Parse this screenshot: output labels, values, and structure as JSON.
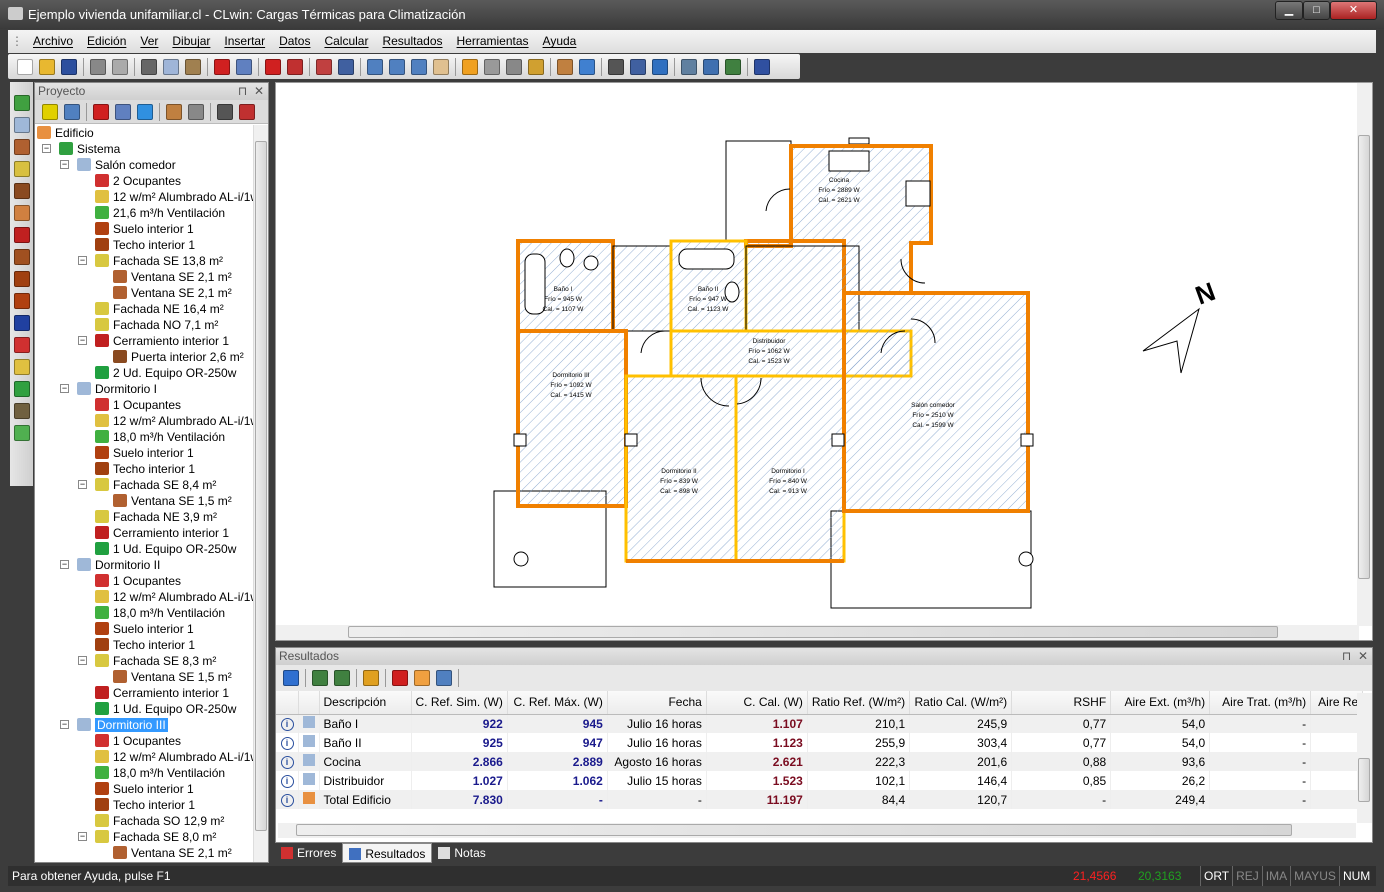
{
  "window": {
    "title": "Ejemplo vivienda unifamiliar.cl - CLwin: Cargas Térmicas para Climatización",
    "minimize": "▁",
    "maximize": "□",
    "close": "✕"
  },
  "menu": [
    "Archivo",
    "Edición",
    "Ver",
    "Dibujar",
    "Insertar",
    "Datos",
    "Calcular",
    "Resultados",
    "Herramientas",
    "Ayuda"
  ],
  "toolbar": [
    {
      "icon": "new-icon",
      "color": "#ffffff"
    },
    {
      "icon": "open-icon",
      "color": "#e8b830"
    },
    {
      "icon": "save-icon",
      "color": "#2c4f9e"
    },
    "|",
    {
      "icon": "print-icon",
      "color": "#888888"
    },
    {
      "icon": "print-preview-icon",
      "color": "#aaaaaa"
    },
    "|",
    {
      "icon": "cut-icon",
      "color": "#666666"
    },
    {
      "icon": "copy-icon",
      "color": "#9fb5d8"
    },
    {
      "icon": "paste-icon",
      "color": "#a08050"
    },
    "|",
    {
      "icon": "delete-icon",
      "color": "#d02020"
    },
    {
      "icon": "edit-icon",
      "color": "#6080c0"
    },
    "|",
    {
      "icon": "sum-icon",
      "color": "#d02020"
    },
    {
      "icon": "report-icon",
      "color": "#c03030"
    },
    "|",
    {
      "icon": "calc-icon",
      "color": "#c04040"
    },
    {
      "icon": "export-icon",
      "color": "#4060a0"
    },
    "|",
    {
      "icon": "zoom-icon",
      "color": "#5080c0"
    },
    {
      "icon": "zoom-in-icon",
      "color": "#5080c0"
    },
    {
      "icon": "zoom-out-icon",
      "color": "#5080c0"
    },
    {
      "icon": "pan-hand-icon",
      "color": "#e0c090"
    },
    "|",
    {
      "icon": "ortho-icon",
      "color": "#f0a020"
    },
    {
      "icon": "grid-icon",
      "color": "#999999"
    },
    {
      "icon": "snap-icon",
      "color": "#888888"
    },
    {
      "icon": "properties-icon",
      "color": "#d0a030"
    },
    "|",
    {
      "icon": "measure-icon",
      "color": "#c08040"
    },
    {
      "icon": "compass-icon",
      "color": "#4080d0"
    },
    "|",
    {
      "icon": "align-icon",
      "color": "#555555"
    },
    {
      "icon": "link-icon",
      "color": "#4060a0"
    },
    {
      "icon": "center-icon",
      "color": "#3070c0"
    },
    "|",
    {
      "icon": "page-icon",
      "color": "#6080a0"
    },
    {
      "icon": "page-export-icon",
      "color": "#4070b0"
    },
    {
      "icon": "page-edit-icon",
      "color": "#408040"
    },
    "|",
    {
      "icon": "layers-icon",
      "color": "#3050a0"
    }
  ],
  "left_tools": [
    {
      "icon": "add-system-icon",
      "color": "#40a040"
    },
    {
      "icon": "add-room-icon",
      "color": "#9fb8d8"
    },
    {
      "icon": "add-window-icon",
      "color": "#b06030"
    },
    {
      "icon": "add-facade-icon",
      "color": "#d8c040"
    },
    {
      "icon": "add-door-icon",
      "color": "#8a4a20"
    },
    {
      "icon": "add-roof-icon",
      "color": "#d08040"
    },
    {
      "icon": "add-wall-icon",
      "color": "#c02020"
    },
    {
      "icon": "add-interior-door-icon",
      "color": "#a05020"
    },
    {
      "icon": "add-ceiling-icon",
      "color": "#a04010"
    },
    {
      "icon": "add-floor-icon",
      "color": "#b04010"
    },
    {
      "icon": "add-pattern-icon",
      "color": "#2040a0"
    },
    {
      "icon": "add-occupants-icon",
      "color": "#d03030"
    },
    {
      "icon": "add-lighting-icon",
      "color": "#e0c040"
    },
    {
      "icon": "add-equipment-icon",
      "color": "#30a040"
    },
    {
      "icon": "add-light-icon",
      "color": "#706040"
    },
    {
      "icon": "add-ventilation-icon",
      "color": "#50b050"
    }
  ],
  "project_panel": {
    "title": "Proyecto",
    "pin": "⊓",
    "close": "✕",
    "tools": [
      {
        "icon": "add-icon",
        "color": "#e0d000"
      },
      {
        "icon": "import-icon",
        "color": "#5080c0"
      },
      "|",
      {
        "icon": "delete-icon",
        "color": "#d02020"
      },
      {
        "icon": "edit-icon",
        "color": "#6080c0"
      },
      {
        "icon": "up-arrow-icon",
        "color": "#3090e0"
      },
      "|",
      {
        "icon": "measure-icon",
        "color": "#c08040"
      },
      {
        "icon": "compass-icon",
        "color": "#888888"
      },
      "|",
      {
        "icon": "table-icon",
        "color": "#555555"
      },
      {
        "icon": "sum-icon",
        "color": "#c03030"
      }
    ],
    "tree": [
      {
        "l": 0,
        "t": "Edificio",
        "i": "building"
      },
      {
        "l": 1,
        "t": "Sistema",
        "i": "system",
        "e": "−"
      },
      {
        "l": 2,
        "t": "Salón comedor",
        "i": "room",
        "e": "−"
      },
      {
        "l": 3,
        "t": "2 Ocupantes",
        "i": "occupants"
      },
      {
        "l": 3,
        "t": "12 w/m² Alumbrado AL-i/1w",
        "i": "lighting"
      },
      {
        "l": 3,
        "t": "21,6 m³/h Ventilación",
        "i": "ventilation"
      },
      {
        "l": 3,
        "t": "Suelo interior 1",
        "i": "floor"
      },
      {
        "l": 3,
        "t": "Techo interior 1",
        "i": "ceiling"
      },
      {
        "l": 3,
        "t": "Fachada SE 13,8 m²",
        "i": "facade",
        "e": "−"
      },
      {
        "l": 4,
        "t": "Ventana SE 2,1 m²",
        "i": "window"
      },
      {
        "l": 4,
        "t": "Ventana SE 2,1 m²",
        "i": "window"
      },
      {
        "l": 3,
        "t": "Fachada NE 16,4 m²",
        "i": "facade"
      },
      {
        "l": 3,
        "t": "Fachada NO 7,1 m²",
        "i": "facade"
      },
      {
        "l": 3,
        "t": "Cerramiento interior 1",
        "i": "wall",
        "e": "−"
      },
      {
        "l": 4,
        "t": "Puerta interior 2,6 m²",
        "i": "door"
      },
      {
        "l": 3,
        "t": "2 Ud. Equipo OR-250w",
        "i": "equipment"
      },
      {
        "l": 2,
        "t": "Dormitorio I",
        "i": "room",
        "e": "−"
      },
      {
        "l": 3,
        "t": "1 Ocupantes",
        "i": "occupants"
      },
      {
        "l": 3,
        "t": "12 w/m² Alumbrado AL-i/1w",
        "i": "lighting"
      },
      {
        "l": 3,
        "t": "18,0 m³/h Ventilación",
        "i": "ventilation"
      },
      {
        "l": 3,
        "t": "Suelo interior 1",
        "i": "floor"
      },
      {
        "l": 3,
        "t": "Techo interior 1",
        "i": "ceiling"
      },
      {
        "l": 3,
        "t": "Fachada SE 8,4 m²",
        "i": "facade",
        "e": "−"
      },
      {
        "l": 4,
        "t": "Ventana SE 1,5 m²",
        "i": "window"
      },
      {
        "l": 3,
        "t": "Fachada NE 3,9 m²",
        "i": "facade"
      },
      {
        "l": 3,
        "t": "Cerramiento interior 1",
        "i": "wall"
      },
      {
        "l": 3,
        "t": "1 Ud. Equipo OR-250w",
        "i": "equipment"
      },
      {
        "l": 2,
        "t": "Dormitorio II",
        "i": "room",
        "e": "−"
      },
      {
        "l": 3,
        "t": "1 Ocupantes",
        "i": "occupants"
      },
      {
        "l": 3,
        "t": "12 w/m² Alumbrado AL-i/1w",
        "i": "lighting"
      },
      {
        "l": 3,
        "t": "18,0 m³/h Ventilación",
        "i": "ventilation"
      },
      {
        "l": 3,
        "t": "Suelo interior 1",
        "i": "floor"
      },
      {
        "l": 3,
        "t": "Techo interior 1",
        "i": "ceiling"
      },
      {
        "l": 3,
        "t": "Fachada SE 8,3 m²",
        "i": "facade",
        "e": "−"
      },
      {
        "l": 4,
        "t": "Ventana SE 1,5 m²",
        "i": "window"
      },
      {
        "l": 3,
        "t": "Cerramiento interior 1",
        "i": "wall"
      },
      {
        "l": 3,
        "t": "1 Ud. Equipo OR-250w",
        "i": "equipment"
      },
      {
        "l": 2,
        "t": "Dormitorio III",
        "i": "room",
        "e": "−",
        "sel": true
      },
      {
        "l": 3,
        "t": "1 Ocupantes",
        "i": "occupants"
      },
      {
        "l": 3,
        "t": "12 w/m² Alumbrado AL-i/1w",
        "i": "lighting"
      },
      {
        "l": 3,
        "t": "18,0 m³/h Ventilación",
        "i": "ventilation"
      },
      {
        "l": 3,
        "t": "Suelo interior 1",
        "i": "floor"
      },
      {
        "l": 3,
        "t": "Techo interior 1",
        "i": "ceiling"
      },
      {
        "l": 3,
        "t": "Fachada SO 12,9 m²",
        "i": "facade"
      },
      {
        "l": 3,
        "t": "Fachada SE 8,0 m²",
        "i": "facade",
        "e": "−"
      },
      {
        "l": 4,
        "t": "Ventana SE 2,1 m²",
        "i": "window"
      }
    ]
  },
  "tree_icon_colors": {
    "building": "#e89040",
    "system": "#30a040",
    "room": "#9fb8d8",
    "occupants": "#d03030",
    "lighting": "#e0c040",
    "ventilation": "#40b040",
    "floor": "#b04010",
    "ceiling": "#a04010",
    "facade": "#d8c840",
    "window": "#b06030",
    "wall": "#c02020",
    "door": "#8a4a20",
    "equipment": "#20a040"
  },
  "plan": {
    "north": "N",
    "rooms": [
      {
        "name": "Cocina",
        "frio": "Frío = 2889 W",
        "cal": "Cal. = 2621 W"
      },
      {
        "name": "Baño I",
        "frio": "Frío = 945 W",
        "cal": "Cal. = 1107 W"
      },
      {
        "name": "Baño II",
        "frio": "Frío = 947 W",
        "cal": "Cal. = 1123 W"
      },
      {
        "name": "Distribuidor",
        "frio": "Frío = 1062 W",
        "cal": "Cal. = 1523 W"
      },
      {
        "name": "Dormitorio III",
        "frio": "Frío = 1092 W",
        "cal": "Cal. = 1415 W"
      },
      {
        "name": "Dormitorio II",
        "frio": "Frío = 839 W",
        "cal": "Cal. = 898 W"
      },
      {
        "name": "Dormitorio I",
        "frio": "Frío = 840 W",
        "cal": "Cal. = 913 W"
      },
      {
        "name": "Salón comedor",
        "frio": "Frío = 2510 W",
        "cal": "Cal. = 1599 W"
      }
    ],
    "wall_color": "#f08000",
    "interior_wall_color": "#ffc000",
    "hatch_color": "#7a9cc8"
  },
  "results": {
    "title": "Resultados",
    "pin": "⊓",
    "close": "✕",
    "tools": [
      {
        "icon": "check-icon",
        "color": "#3070d0"
      },
      "|",
      {
        "icon": "import-icon",
        "color": "#408040"
      },
      {
        "icon": "export-icon",
        "color": "#408040"
      },
      "|",
      {
        "icon": "select-icon",
        "color": "#e0a020"
      },
      "|",
      {
        "icon": "delete-icon",
        "color": "#d02020"
      },
      {
        "icon": "move-icon",
        "color": "#f0a040"
      },
      {
        "icon": "find-icon",
        "color": "#5080c0"
      },
      "|"
    ],
    "columns": [
      "Descripción",
      "C. Ref. Sim. (W)",
      "C. Ref. Máx. (W)",
      "Fecha",
      "C. Cal. (W)",
      "Ratio Ref. (W/m²)",
      "Ratio Cal. (W/m²)",
      "RSHF",
      "Aire Ext. (m³/h)",
      "Aire Trat. (m³/h)",
      "Aire Re"
    ],
    "rows": [
      [
        "Baño I",
        "922",
        "945",
        "Julio 16 horas",
        "1.107",
        "210,1",
        "245,9",
        "0,77",
        "54,0",
        "-",
        ""
      ],
      [
        "Baño II",
        "925",
        "947",
        "Julio 16 horas",
        "1.123",
        "255,9",
        "303,4",
        "0,77",
        "54,0",
        "-",
        ""
      ],
      [
        "Cocina",
        "2.866",
        "2.889",
        "Agosto 16 horas",
        "2.621",
        "222,3",
        "201,6",
        "0,88",
        "93,6",
        "-",
        ""
      ],
      [
        "Distribuidor",
        "1.027",
        "1.062",
        "Julio 15 horas",
        "1.523",
        "102,1",
        "146,4",
        "0,85",
        "26,2",
        "-",
        ""
      ],
      [
        "Total Edificio",
        "7.830",
        "-",
        "-",
        "11.197",
        "84,4",
        "120,7",
        "-",
        "249,4",
        "-",
        ""
      ]
    ],
    "info_glyph": "i"
  },
  "tabs": [
    {
      "label": "Errores",
      "icon": "errors-icon",
      "color": "#d03030"
    },
    {
      "label": "Resultados",
      "icon": "results-icon",
      "color": "#4070c0",
      "active": true
    },
    {
      "label": "Notas",
      "icon": "notes-icon",
      "color": "#dddddd"
    }
  ],
  "status": {
    "help": "Para obtener Ayuda, pulse F1",
    "x": "21,4566",
    "y": "20,3163",
    "x_color": "#ff2020",
    "y_color": "#20a020",
    "flags": [
      {
        "t": "ORT",
        "on": true
      },
      {
        "t": "REJ",
        "on": false
      },
      {
        "t": "IMA",
        "on": false
      },
      {
        "t": "MAYUS",
        "on": false
      },
      {
        "t": "NUM",
        "on": true
      }
    ]
  }
}
